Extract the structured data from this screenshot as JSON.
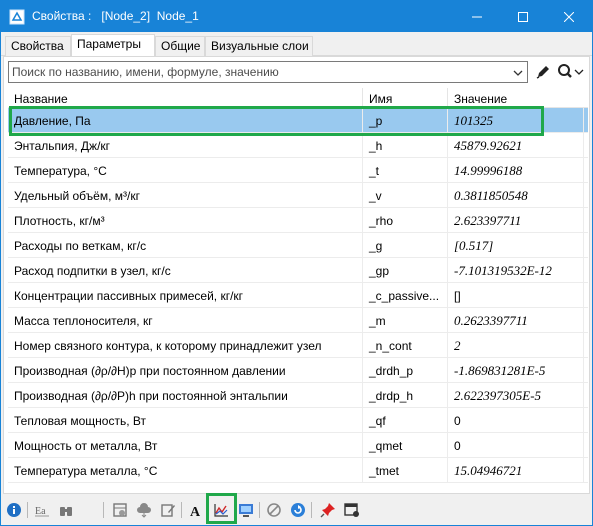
{
  "window": {
    "title": "Свойства :   [Node_2]  Node_1",
    "accent_color": "#1883d7",
    "controls": {
      "minimize_icon": "minimize-icon",
      "maximize_icon": "maximize-icon",
      "close_icon": "close-icon"
    }
  },
  "tabs": [
    {
      "label": "Свойства",
      "active": false
    },
    {
      "label": "Параметры",
      "active": true
    },
    {
      "label": "Общие",
      "active": false
    },
    {
      "label": "Визуальные слои",
      "active": false
    }
  ],
  "search": {
    "placeholder": "Поиск по названию, имени, формуле, значению",
    "value": ""
  },
  "table": {
    "columns": [
      "Название",
      "Имя",
      "Значение"
    ],
    "rows": [
      {
        "name": "Давление, Па",
        "var": "_p",
        "value": "101325",
        "italic": true,
        "selected": true
      },
      {
        "name": "Энтальпия, Дж/кг",
        "var": "_h",
        "value": "45879.92621",
        "italic": true
      },
      {
        "name": "Температура, °С",
        "var": "_t",
        "value": "14.99996188",
        "italic": true
      },
      {
        "name": "Удельный объём, м³/кг",
        "var": "_v",
        "value": "0.3811850548",
        "italic": true
      },
      {
        "name": "Плотность, кг/м³",
        "var": "_rho",
        "value": "2.623397711",
        "italic": true
      },
      {
        "name": "Расходы по веткам, кг/с",
        "var": "_g",
        "value": "[0.517]",
        "italic": true
      },
      {
        "name": "Расход подпитки в узел, кг/с",
        "var": "_gp",
        "value": "-7.101319532E-12",
        "italic": true
      },
      {
        "name": "Концентрации пассивных примесей, кг/кг",
        "var": "_c_passive...",
        "value": "[]",
        "italic": false
      },
      {
        "name": "Масса теплоносителя, кг",
        "var": "_m",
        "value": "0.2623397711",
        "italic": true
      },
      {
        "name": "Номер связного контура, к которому принадлежит узел",
        "var": "_n_cont",
        "value": "2",
        "italic": true
      },
      {
        "name": "Производная (∂ρ/∂H)p при постоянном давлении",
        "var": "_drdh_p",
        "value": "-1.869831281E-5",
        "italic": true
      },
      {
        "name": "Производная (∂ρ/∂P)h при постоянной энтальпии",
        "var": "_drdp_h",
        "value": "2.622397305E-5",
        "italic": true
      },
      {
        "name": "Тепловая мощность, Вт",
        "var": "_qf",
        "value": "0",
        "italic": false
      },
      {
        "name": "Мощность от металла, Вт",
        "var": "_qmet",
        "value": "0",
        "italic": false
      },
      {
        "name": "Температура металла, °С",
        "var": "_tmet",
        "value": "15.04946721",
        "italic": true
      }
    ]
  },
  "highlight_color": "#20a84a",
  "selection_color": "#99c9ef",
  "toolbar_icons": [
    "info-icon",
    "sort-alpha-icon",
    "binoculars-icon",
    "table-copy-icon",
    "cloud-sync-icon",
    "edit-icon",
    "text-font-icon",
    "chart-icon",
    "monitor-icon",
    "disable-icon",
    "refresh-icon",
    "pin-icon",
    "window-settings-icon"
  ]
}
